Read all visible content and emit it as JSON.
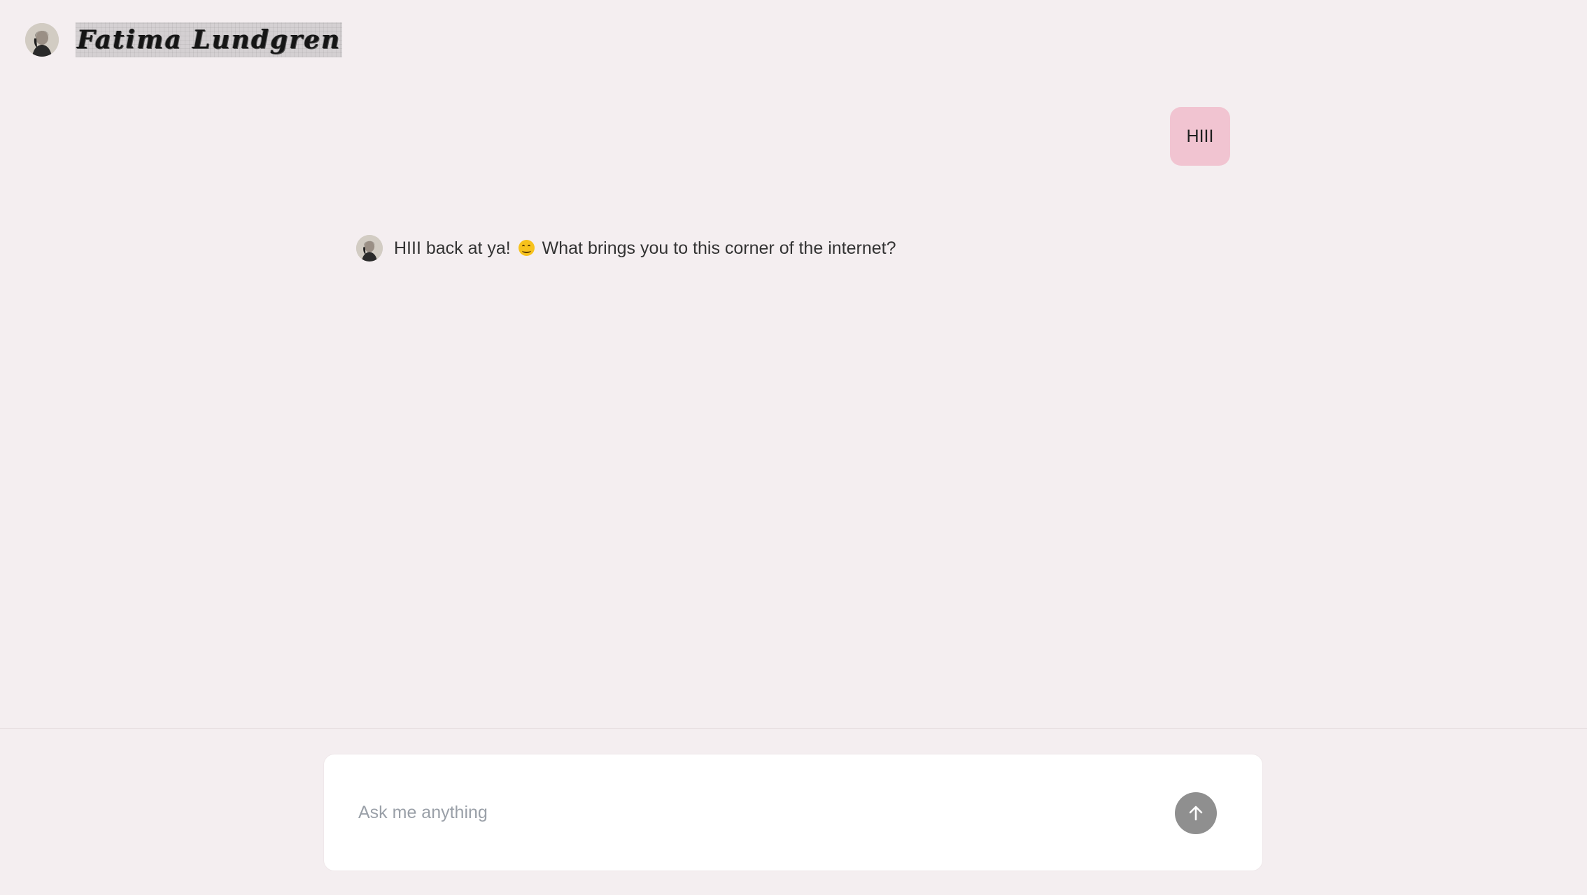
{
  "header": {
    "avatar_icon": "profile-photo-avatar",
    "title": "Fatima Lundgren"
  },
  "messages": [
    {
      "role": "user",
      "text": "HIII"
    },
    {
      "role": "assistant",
      "text_before": "HIII back at ya!",
      "emoji": "smiling-face",
      "text_after": "What brings you to this corner of the internet?"
    }
  ],
  "composer": {
    "placeholder": "Ask me anything",
    "value": "",
    "send_icon": "arrow-up-icon"
  },
  "colors": {
    "background": "#f4eef0",
    "user_bubble": "#f1c4d1",
    "send_button": "#8f8f8f",
    "composer_bg": "#ffffff"
  }
}
